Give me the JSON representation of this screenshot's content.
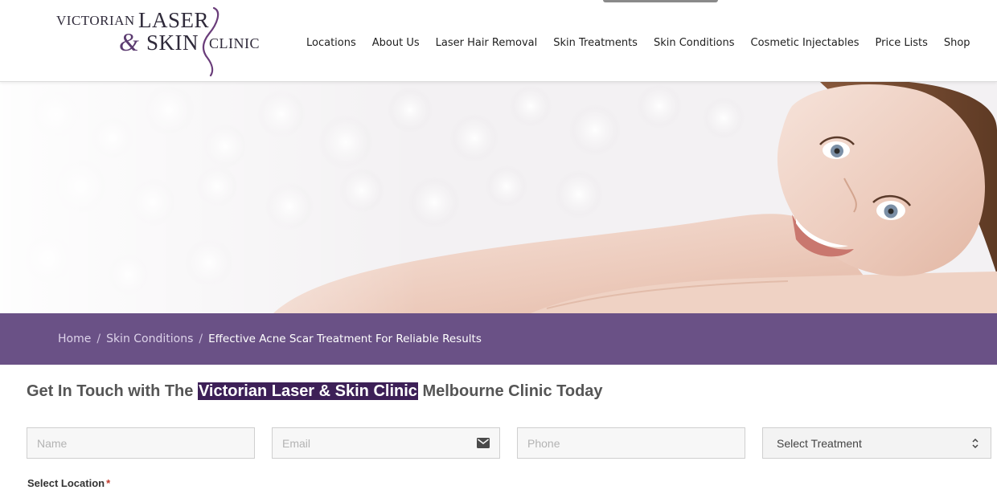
{
  "logo": {
    "word1": "VICTORIAN",
    "word2": "LASER",
    "ampersand": "&",
    "word3": "SKIN",
    "word4": "CLINIC"
  },
  "nav": {
    "items": [
      "Locations",
      "About Us",
      "Laser Hair Removal",
      "Skin Treatments",
      "Skin Conditions",
      "Cosmetic Injectables",
      "Price Lists",
      "Shop"
    ]
  },
  "breadcrumb": {
    "home": "Home",
    "separator": "/",
    "section": "Skin Conditions",
    "current": "Effective Acne Scar Treatment For Reliable Results"
  },
  "contact": {
    "title_before": "Get In Touch with The ",
    "title_highlight": "Victorian Laser & Skin Clinic",
    "title_after": " Melbourne Clinic Today",
    "name_placeholder": "Name",
    "email_placeholder": "Email",
    "phone_placeholder": "Phone",
    "treatment_selected": "Select Treatment",
    "location_label": "Select Location",
    "required_mark": "*"
  },
  "colors": {
    "brand_purple": "#6a5186",
    "highlight": "#3d2057"
  },
  "icons": {
    "email": "envelope-icon",
    "select": "updown-arrows-icon"
  }
}
